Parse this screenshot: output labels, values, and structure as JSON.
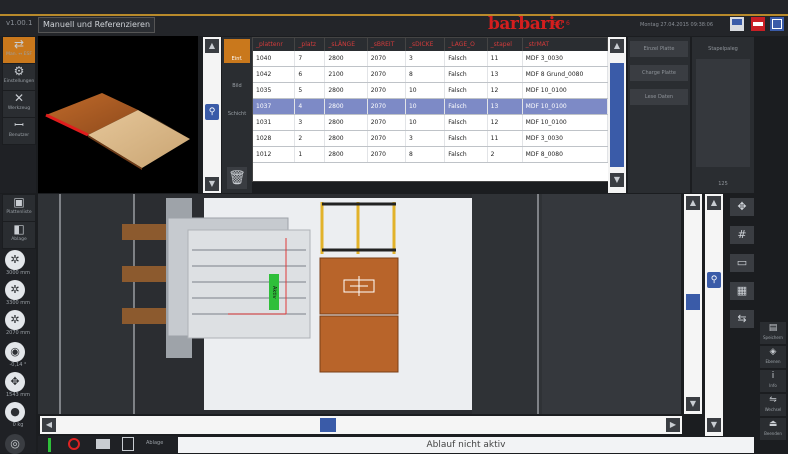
{
  "header": {
    "version": "v1.00.1",
    "mode_label": "Manuell und Referenzieren",
    "brand": "barbaric",
    "brand_sub": "ESF 6",
    "stamp": "Montag 27.04.2015 09:38:06"
  },
  "left_tools": [
    {
      "icon": "machine-icon",
      "label": "Man. ↔ ESF"
    },
    {
      "icon": "settings-icon",
      "label": "Einstellungen"
    },
    {
      "icon": "tools-icon",
      "label": "Werkzeug"
    },
    {
      "icon": "users-icon",
      "label": "Benutzer"
    }
  ],
  "left_view_buttons": [
    {
      "icon": "plate-view-icon",
      "label": "Plattenliste"
    },
    {
      "icon": "layout-icon",
      "label": "Ablage"
    }
  ],
  "axes": [
    {
      "icon": "fan-icon",
      "value": "3000 mm"
    },
    {
      "icon": "fan-icon",
      "value": "3300 mm"
    },
    {
      "icon": "fan-icon",
      "value": "2070 mm"
    },
    {
      "icon": "rotate-icon",
      "value": "-0,14 °"
    },
    {
      "icon": "move-icon",
      "value": "1543 mm"
    },
    {
      "icon": "weight-icon",
      "value": "0 kg"
    }
  ],
  "list_actions": [
    "Einf.",
    "Bild",
    "Schicht"
  ],
  "table": {
    "columns": [
      "_plattenr",
      "_platz",
      "_sLÄNGE",
      "_sBREIT",
      "_sDICKE",
      "_LAGE_O",
      "_stapel",
      "_strMAT"
    ],
    "rows": [
      [
        "1040",
        "7",
        "2800",
        "2070",
        "3",
        "Falsch",
        "11",
        "MDF 3_0030"
      ],
      [
        "1042",
        "6",
        "2100",
        "2070",
        "8",
        "Falsch",
        "13",
        "MDF 8 Grund_0080"
      ],
      [
        "1035",
        "5",
        "2800",
        "2070",
        "10",
        "Falsch",
        "12",
        "MDF 10_0100"
      ],
      [
        "1037",
        "4",
        "2800",
        "2070",
        "10",
        "Falsch",
        "13",
        "MDF 10_0100"
      ],
      [
        "1031",
        "3",
        "2800",
        "2070",
        "10",
        "Falsch",
        "12",
        "MDF 10_0100"
      ],
      [
        "1028",
        "2",
        "2800",
        "2070",
        "3",
        "Falsch",
        "11",
        "MDF 3_0030"
      ],
      [
        "1012",
        "1",
        "2800",
        "2070",
        "8",
        "Falsch",
        "2",
        "MDF 8_0080"
      ]
    ],
    "selected_index": 3
  },
  "right_actions": [
    "Einzel Platte",
    "Charge Platte",
    "Lese Daten"
  ],
  "palette_label": "Stapelpaleg",
  "palette_value": "125",
  "machine_label": "Aktiv",
  "right_side_tools": [
    {
      "icon": "disk-icon",
      "label": "Speichern"
    },
    {
      "icon": "layers-icon",
      "label": "Ebenen"
    },
    {
      "icon": "info-icon",
      "label": "Info"
    },
    {
      "icon": "exchange-icon",
      "label": "Wechsel"
    },
    {
      "icon": "exit-icon",
      "label": "Beenden"
    }
  ],
  "status_text": "Ablauf nicht aktiv",
  "bottom_label": "Ablage",
  "colors": {
    "accent_gold": "#b88a2b",
    "brand_red": "#d41e1e",
    "selection": "#7d8ac6",
    "active_green": "#2fbf3a",
    "wood": "#b8642a"
  }
}
